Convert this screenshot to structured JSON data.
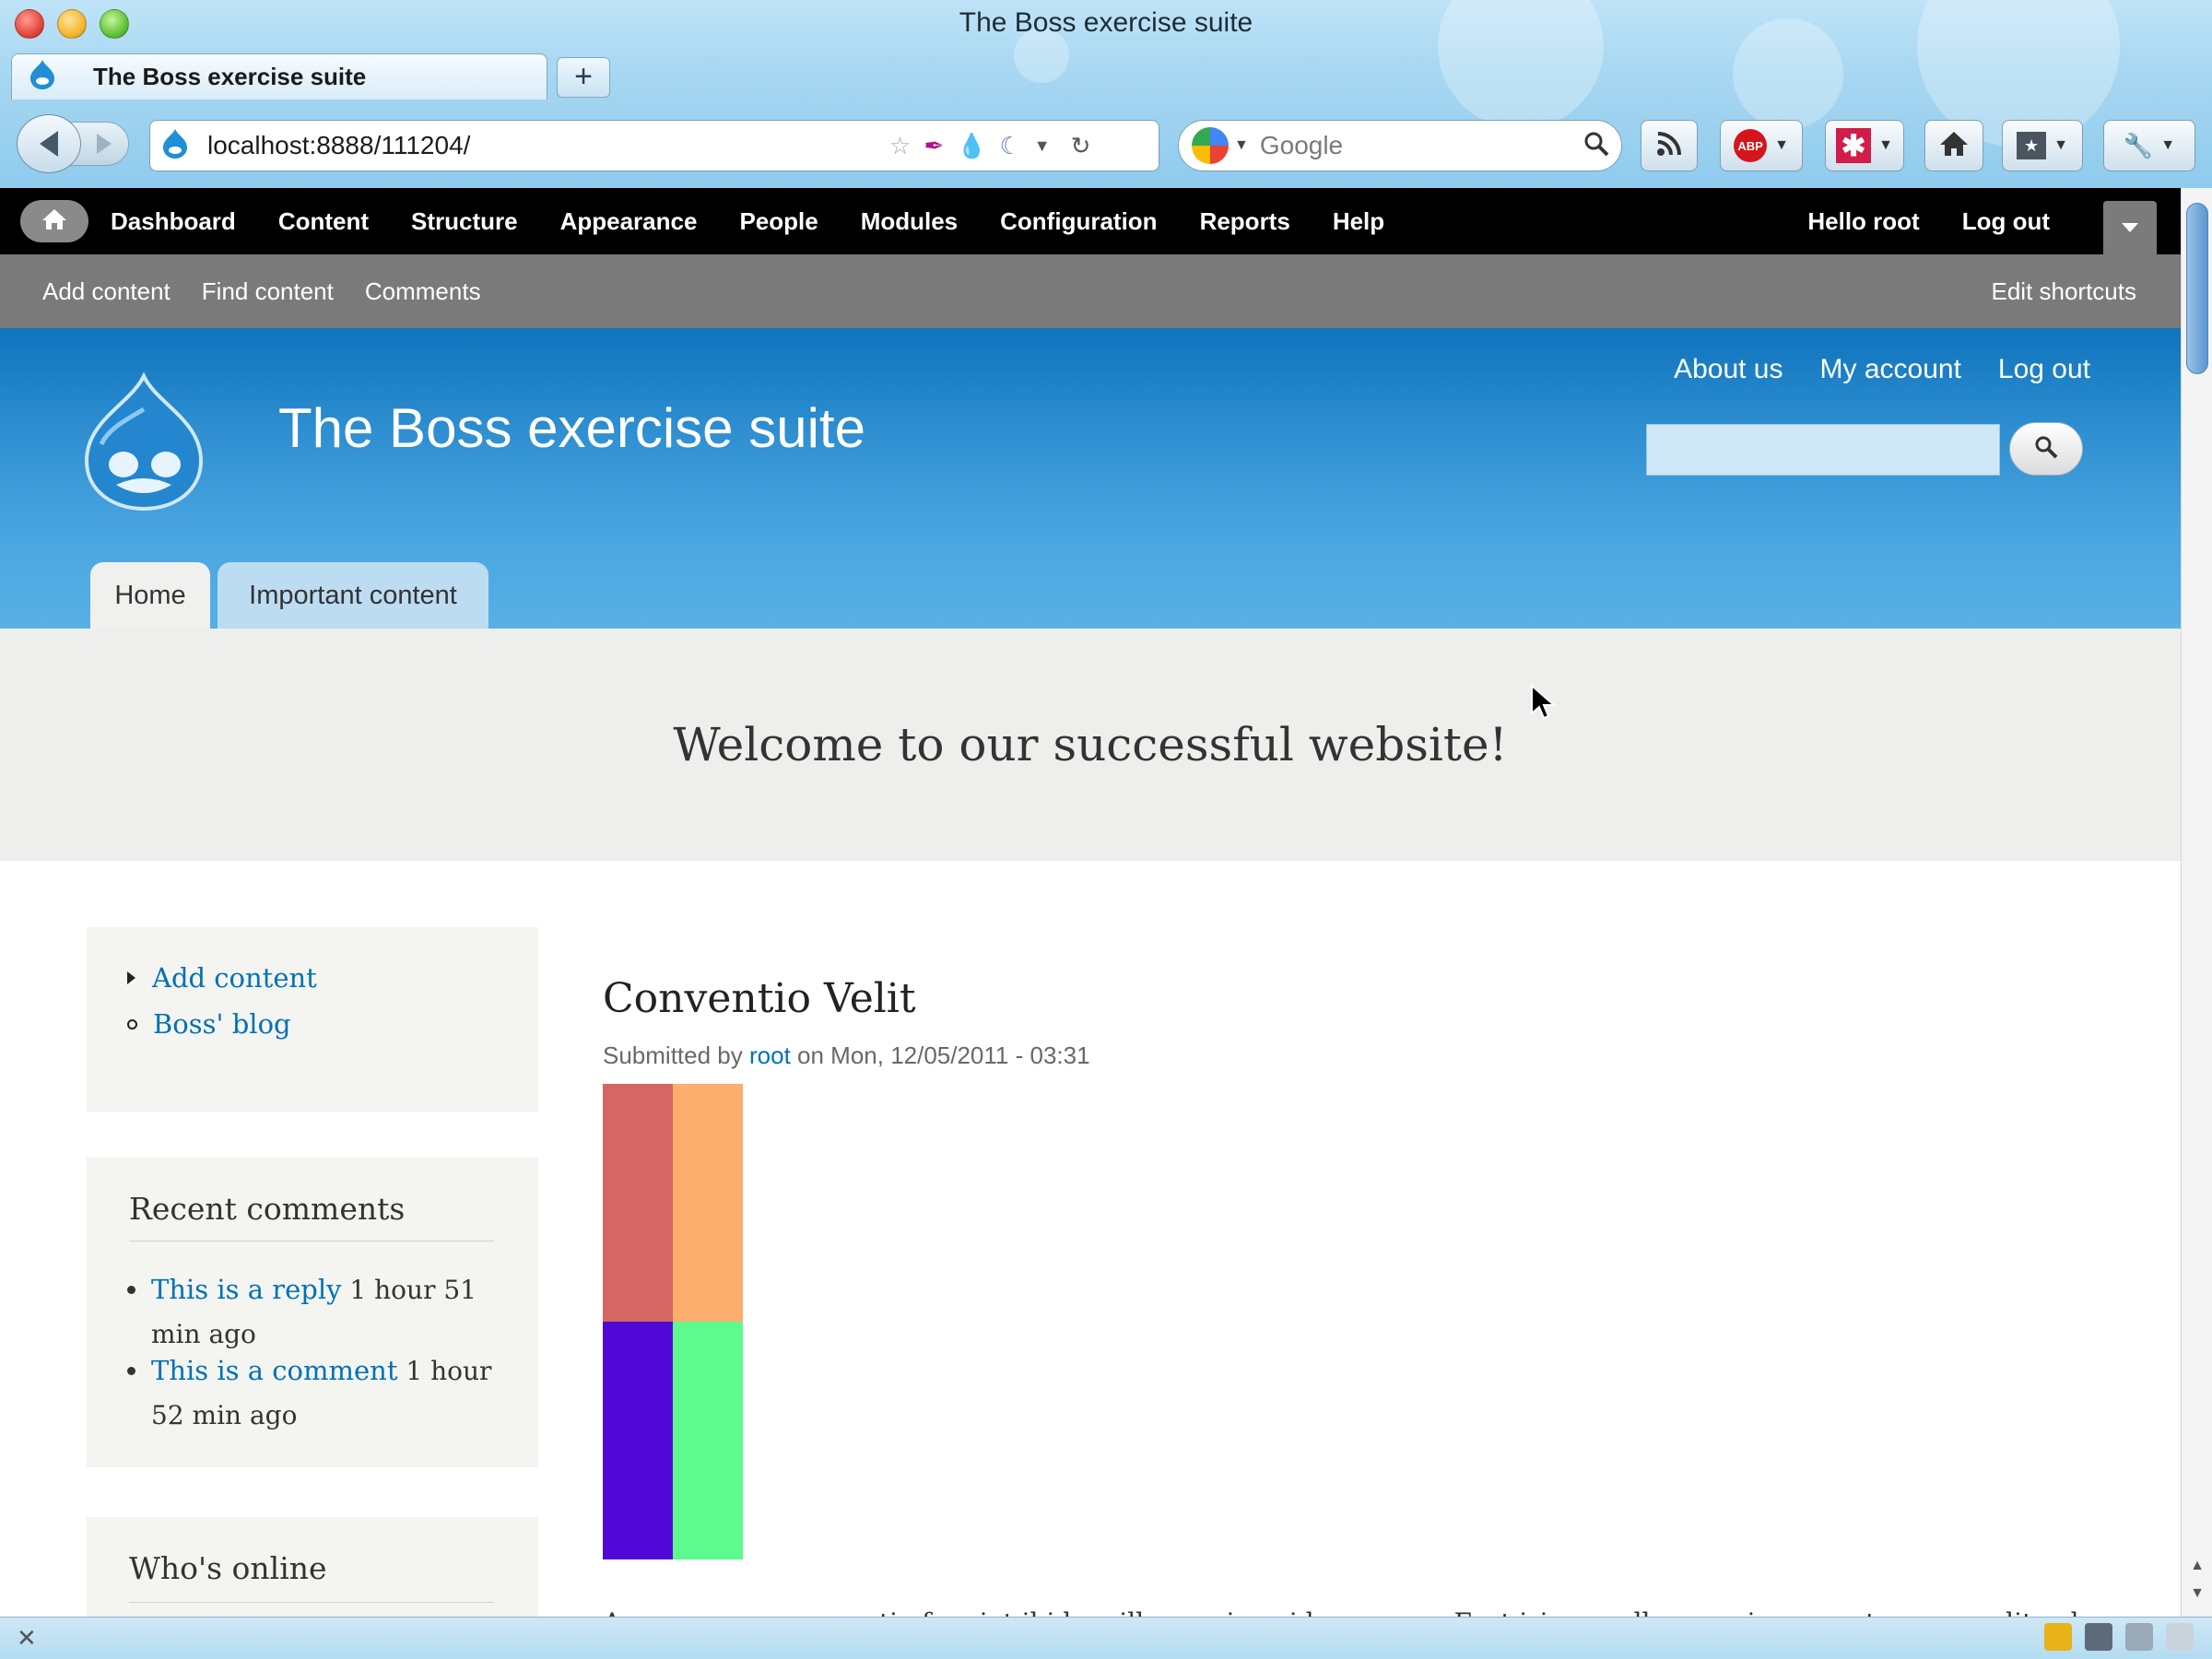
{
  "browser": {
    "window_title": "The Boss exercise suite",
    "tab_title": "The Boss exercise suite",
    "new_tab_label": "+",
    "url": "localhost:8888/111204/",
    "search_engine": "Google",
    "search_placeholder": "Google"
  },
  "admin_toolbar": {
    "items": [
      "Dashboard",
      "Content",
      "Structure",
      "Appearance",
      "People",
      "Modules",
      "Configuration",
      "Reports",
      "Help"
    ],
    "hello_prefix": "Hello ",
    "user": "root",
    "logout": "Log out"
  },
  "shortcuts": {
    "items": [
      "Add content",
      "Find content",
      "Comments"
    ],
    "edit": "Edit shortcuts"
  },
  "header": {
    "site_name": "The Boss exercise suite",
    "secondary_menu": [
      "About us",
      "My account",
      "Log out"
    ],
    "tabs": [
      "Home",
      "Important content"
    ]
  },
  "featured": {
    "text": "Welcome to our successful website!"
  },
  "sidebar": {
    "nav_links": [
      "Add content",
      "Boss' blog"
    ],
    "recent_comments": {
      "title": "Recent comments",
      "items": [
        {
          "link": "This is a reply",
          "time": " 1 hour 51 min ago"
        },
        {
          "link": "This is a comment",
          "time": " 1 hour 52 min ago"
        }
      ]
    },
    "whos_online": {
      "title": "Who's online"
    }
  },
  "node": {
    "title": "Conventio Velit",
    "submitted_prefix": "Submitted by ",
    "author": "root",
    "submitted_suffix": " on Mon, 12/05/2011 - 03:31",
    "image_colors": [
      "#d56663",
      "#fbae6e",
      "#5108d6",
      "#5dfb8f"
    ],
    "teaser": "Augue camur conventio feugiat ibidem illum quis quidem saepe. Erat iriure nulla proprius quae torqueo velit vel."
  },
  "colors": {
    "admin_bar": "#000000",
    "shortcut_bar": "#7a7a7a",
    "header_blue": "#2f8fd1",
    "link": "#0071b3"
  }
}
